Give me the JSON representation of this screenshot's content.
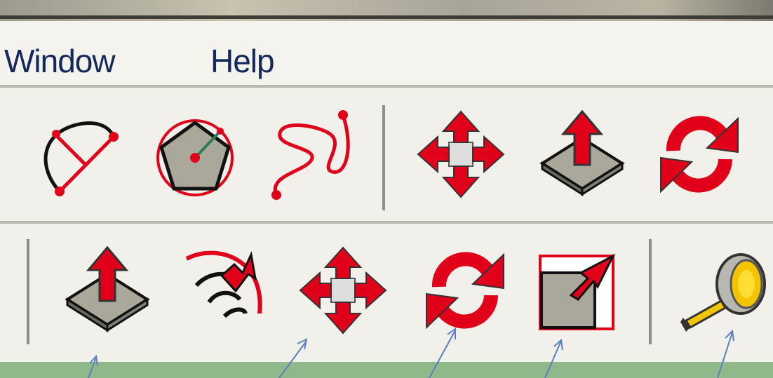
{
  "menu": {
    "items": [
      {
        "label": "Window"
      },
      {
        "label": "Help"
      }
    ]
  },
  "toolbar_top": {
    "icons": [
      "arc-tool-icon",
      "polygon-tool-icon",
      "freehand-tool-icon",
      "move-tool-icon",
      "push-pull-tool-icon",
      "rotate-tool-icon"
    ]
  },
  "toolbar_bottom": {
    "icons": [
      "push-pull-tool-icon",
      "follow-me-tool-icon",
      "move-tool-icon",
      "rotate-tool-icon",
      "scale-tool-icon",
      "tape-measure-tool-icon"
    ]
  },
  "annotation_arrow_color": "#5a7fbf",
  "colors": {
    "tool_red": "#e0001a",
    "tool_face": "#a9a89a",
    "menu_text": "#14285a"
  }
}
